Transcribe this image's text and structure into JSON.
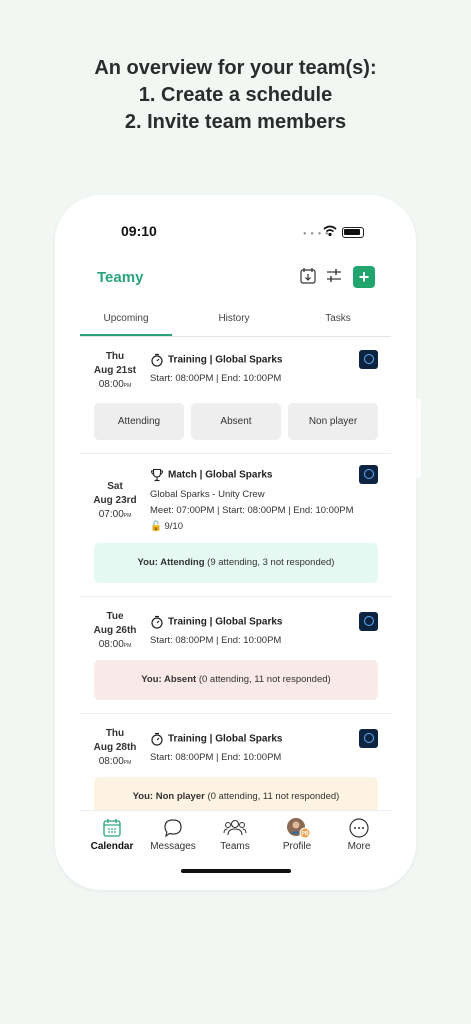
{
  "headline": {
    "line1": "An overview for your team(s):",
    "line2": "1. Create a schedule",
    "line3": "2. Invite team members"
  },
  "status_bar": {
    "time": "09:10"
  },
  "header": {
    "title": "Teamy",
    "add_label": "+"
  },
  "tabs": [
    {
      "label": "Upcoming",
      "active": true
    },
    {
      "label": "History",
      "active": false
    },
    {
      "label": "Tasks",
      "active": false
    }
  ],
  "events": [
    {
      "dow": "Thu",
      "md": "Aug 21st",
      "time": "08:00",
      "time_suffix": "PM",
      "icon": "stopwatch-icon",
      "title": "Training | Global Sparks",
      "line1": "Start: 08:00PM | End: 10:00PM",
      "buttons": [
        "Attending",
        "Absent",
        "Non player"
      ]
    },
    {
      "dow": "Sat",
      "md": "Aug 23rd",
      "time": "07:00",
      "time_suffix": "PM",
      "icon": "trophy-icon",
      "title": "Match | Global Sparks",
      "line1": "Global Sparks - Unity Crew",
      "line2": "Meet: 07:00PM | Start: 08:00PM | End: 10:00PM",
      "line3": "9/10",
      "status_bold": "You: Attending",
      "status_rest": "(9 attending, 3 not responded)",
      "status_color": "#e6f8f2"
    },
    {
      "dow": "Tue",
      "md": "Aug 26th",
      "time": "08:00",
      "time_suffix": "PM",
      "icon": "stopwatch-icon",
      "title": "Training | Global Sparks",
      "line1": "Start: 08:00PM | End: 10:00PM",
      "status_bold": "You: Absent",
      "status_rest": "(0 attending, 11 not responded)",
      "status_color": "#f9e9e7"
    },
    {
      "dow": "Thu",
      "md": "Aug 28th",
      "time": "08:00",
      "time_suffix": "PM",
      "icon": "stopwatch-icon",
      "title": "Training | Global Sparks",
      "line1": "Start: 08:00PM | End: 10:00PM",
      "status_bold": "You: Non player",
      "status_rest": "(0 attending, 11 not responded)",
      "status_color": "#fdf3e2"
    }
  ],
  "bottom_nav": [
    {
      "label": "Calendar",
      "icon": "calendar-icon",
      "active": true
    },
    {
      "label": "Messages",
      "icon": "chat-bubble-icon",
      "active": false
    },
    {
      "label": "Teams",
      "icon": "people-icon",
      "active": false
    },
    {
      "label": "Profile",
      "icon": "avatar-icon",
      "badge": "PB",
      "active": false
    },
    {
      "label": "More",
      "icon": "more-icon",
      "active": false
    }
  ],
  "colors": {
    "accent": "#2aa37a",
    "add_button": "#22a56c"
  }
}
